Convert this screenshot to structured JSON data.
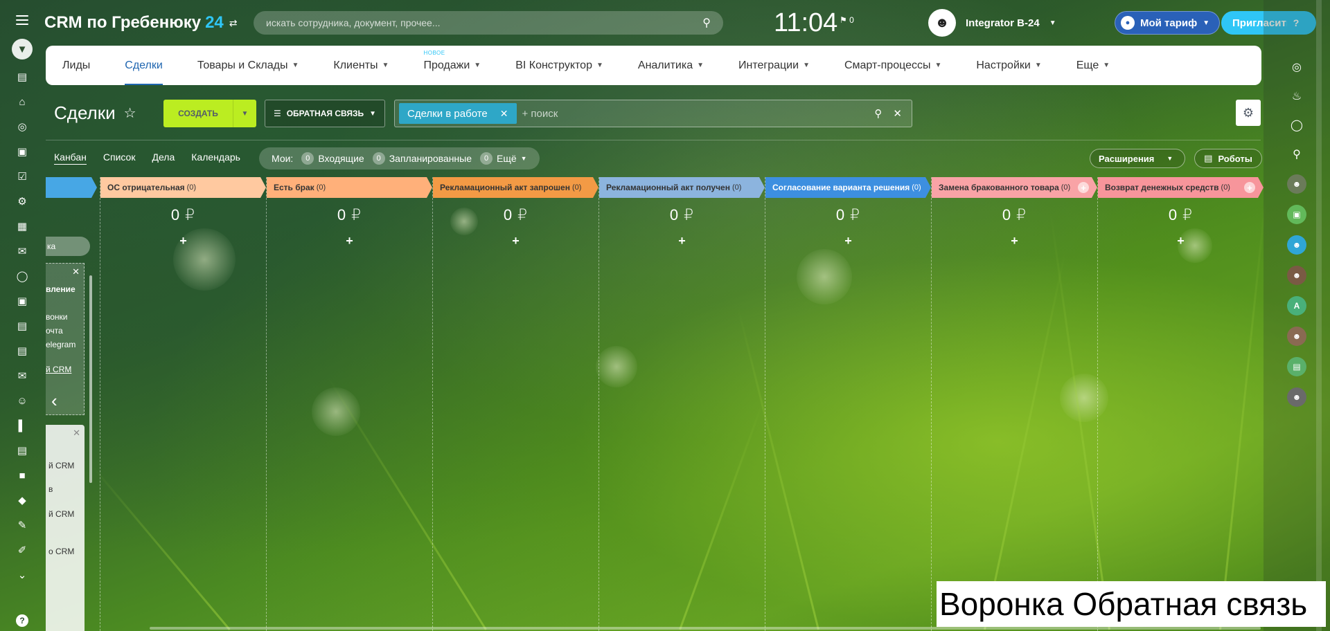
{
  "header": {
    "logo_text": "CRM по Гребенюку",
    "logo_num": "24",
    "search_placeholder": "искать сотрудника, документ, прочее...",
    "clock": "11:04",
    "flag_count": "0",
    "user_name": "Integrator B-24",
    "tariff_label": "Мой тариф",
    "invite_label": "Пригласить",
    "help_label": "?"
  },
  "nav": {
    "new_badge": "НОВОЕ",
    "items": [
      {
        "label": "Лиды",
        "chev": false
      },
      {
        "label": "Сделки",
        "chev": false,
        "active": true
      },
      {
        "label": "Товары и Склады",
        "chev": true
      },
      {
        "label": "Клиенты",
        "chev": true
      },
      {
        "label": "Продажи",
        "chev": true,
        "badge": true
      },
      {
        "label": "BI Конструктор",
        "chev": true
      },
      {
        "label": "Аналитика",
        "chev": true
      },
      {
        "label": "Интеграции",
        "chev": true
      },
      {
        "label": "Смарт-процессы",
        "chev": true
      },
      {
        "label": "Настройки",
        "chev": true
      },
      {
        "label": "Еще",
        "chev": true
      }
    ]
  },
  "toolbar": {
    "title": "Сделки",
    "create_label": "СОЗДАТЬ",
    "category_label": "ОБРАТНАЯ СВЯЗЬ",
    "filter_chip": "Сделки в работе",
    "filter_placeholder": "+ поиск"
  },
  "views": {
    "items": [
      "Канбан",
      "Список",
      "Дела",
      "Календарь"
    ],
    "active": "Канбан",
    "counters_label": "Мои:",
    "counters": [
      {
        "count": "0",
        "label": "Входящие"
      },
      {
        "count": "0",
        "label": "Запланированные"
      },
      {
        "count": "0",
        "label": "Ещё"
      }
    ],
    "extensions_label": "Расширения",
    "robots_label": "Роботы"
  },
  "stages": [
    {
      "name": "ОС отрицательная",
      "count": "(0)",
      "sum": "0 ₽",
      "color": "#ffc9a0",
      "has_plus": false
    },
    {
      "name": "Есть брак",
      "count": "(0)",
      "sum": "0 ₽",
      "color": "#ffb07a",
      "has_plus": false
    },
    {
      "name": "Рекламационный акт запрошен",
      "count": "(0)",
      "sum": "0 ₽",
      "color": "#f39a45",
      "has_plus": false
    },
    {
      "name": "Рекламационный акт получен",
      "count": "(0)",
      "sum": "0 ₽",
      "color": "#8cb4de",
      "has_plus": false
    },
    {
      "name": "Согласование варианта решения",
      "count": "(0)",
      "sum": "0 ₽",
      "color": "#3d8fe0",
      "has_plus": false
    },
    {
      "name": "Замена бракованного товара",
      "count": "(0)",
      "sum": "0 ₽",
      "color": "#f9a3a6",
      "has_plus": true
    },
    {
      "name": "Возврат денежных средств",
      "count": "(0)",
      "sum": "0 ₽",
      "color": "#f7959b",
      "has_plus": true
    }
  ],
  "side_panel": {
    "pill": "ка",
    "card1_lines": [
      "вление",
      "вонки",
      "очта",
      "elegram",
      "й CRM"
    ],
    "card2_lines": [
      "й CRM",
      "в",
      "й CRM",
      "о CRM"
    ]
  },
  "caption": "Воронка Обратная связь",
  "colors": {
    "accent": "#2fc6f6",
    "create": "#bbed21",
    "active_nav": "#2066b0",
    "filter_chip": "#2ea7c7"
  }
}
